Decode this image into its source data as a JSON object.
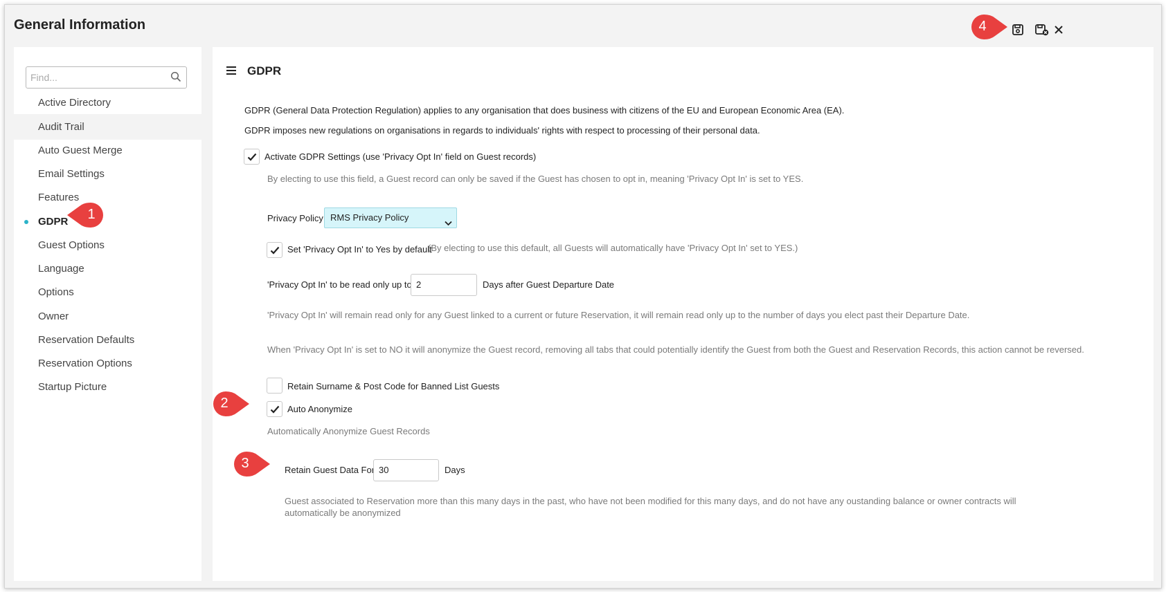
{
  "window": {
    "title": "General Information"
  },
  "toolbar": {
    "save_icon": "save-icon",
    "save_close_icon": "save-close-icon",
    "close_icon": "close-icon"
  },
  "sidebar": {
    "search_placeholder": "Find...",
    "items": [
      {
        "label": "Active Directory"
      },
      {
        "label": "Audit Trail"
      },
      {
        "label": "Auto Guest Merge"
      },
      {
        "label": "Email Settings"
      },
      {
        "label": "Features"
      },
      {
        "label": "GDPR"
      },
      {
        "label": "Guest Options"
      },
      {
        "label": "Language"
      },
      {
        "label": "Options"
      },
      {
        "label": "Owner"
      },
      {
        "label": "Reservation Defaults"
      },
      {
        "label": "Reservation Options"
      },
      {
        "label": "Startup Picture"
      }
    ],
    "active_item": "GDPR"
  },
  "main": {
    "title": "GDPR",
    "intro_1": "GDPR (General Data Protection Regulation) applies to any organisation that does business with citizens of the EU and European Economic Area (EA).",
    "intro_2": "GDPR imposes new regulations on organisations in regards to individuals' rights with respect to processing of their personal data.",
    "activate_label": "Activate GDPR Settings (use 'Privacy Opt In' field on Guest records)",
    "activate_checked": true,
    "activate_desc": "By electing to use this field, a Guest record can only be saved if the Guest has chosen to opt in, meaning 'Privacy Opt In' is set to YES.",
    "privacy_policy_label": "Privacy Policy",
    "privacy_policy_value": "RMS Privacy Policy",
    "optin_default_label": "Set 'Privacy Opt In' to Yes by default",
    "optin_default_checked": true,
    "optin_default_note": "(By electing to use this default, all Guests will automatically have 'Privacy Opt In' set to YES.)",
    "readonly_label": "'Privacy Opt In' to be read only up to",
    "readonly_value": "2",
    "readonly_suffix": "Days after Guest Departure Date",
    "readonly_desc": "'Privacy Opt In' will remain read only for any Guest linked to a current or future Reservation, it will remain read only up to the number of days you elect past their Departure Date.",
    "anonymize_desc": "When 'Privacy Opt In' is set to NO it will anonymize the Guest record, removing all tabs that could potentially identify the Guest from both the Guest and Reservation Records, this action cannot be reversed.",
    "retain_surname_label": "Retain Surname & Post Code for Banned List Guests",
    "retain_surname_checked": false,
    "auto_anonymize_label": "Auto Anonymize",
    "auto_anonymize_checked": true,
    "auto_anonymize_desc": "Automatically Anonymize Guest Records",
    "retain_data_label": "Retain Guest Data For",
    "retain_data_value": "30",
    "retain_data_suffix": "Days",
    "retain_data_desc": "Guest associated to Reservation more than this many days in the past, who have not been modified for this many days, and do not have any oustanding balance or owner contracts will automatically be anonymized"
  },
  "callouts": [
    "1",
    "2",
    "3",
    "4"
  ],
  "colors": {
    "accent": "#2bb3c8",
    "callout": "#e8403f",
    "select_bg": "#d6f5fa"
  }
}
